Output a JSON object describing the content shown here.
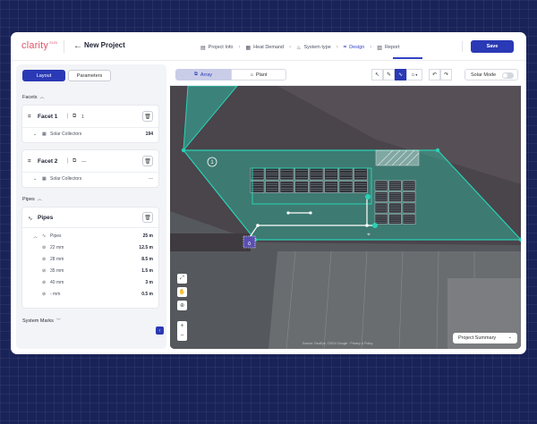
{
  "app": {
    "logo": "clarity",
    "logo_sup": "SUN",
    "project_title": "New Project",
    "back_icon": "arrow-left-icon",
    "save_label": "Save"
  },
  "steps": [
    {
      "label": "Project Info",
      "icon": "document-icon",
      "active": false
    },
    {
      "label": "Heat Demand",
      "icon": "table-icon",
      "active": false
    },
    {
      "label": "System type",
      "icon": "flame-icon",
      "active": false
    },
    {
      "label": "Design",
      "icon": "design-icon",
      "active": true
    },
    {
      "label": "Report",
      "icon": "report-icon",
      "active": false
    }
  ],
  "sidebar": {
    "tabs": {
      "layout": "Layout",
      "parameters": "Parameters"
    },
    "facets_label": "Facets",
    "facet1": {
      "title": "Facet 1",
      "count": "1",
      "sub": "Solar Collectors",
      "value": "194"
    },
    "facet2": {
      "title": "Facet 2",
      "count": "—",
      "sub": "Solar Collectors",
      "value": "—"
    },
    "pipes_label": "Pipes",
    "pipes_card": {
      "title": "Pipes",
      "summary_label": "Pipes",
      "summary_value": "25 m",
      "rows": [
        {
          "label": "22 mm",
          "value": "12.5 m"
        },
        {
          "label": "28 mm",
          "value": "8.5 m"
        },
        {
          "label": "35 mm",
          "value": "1.5 m"
        },
        {
          "label": "40 mm",
          "value": "3 m"
        },
        {
          "label": "- mm",
          "value": "0.5 m"
        }
      ]
    },
    "system_marks_label": "System Marks"
  },
  "map": {
    "tabs": {
      "array": "Array",
      "plant": "Plant"
    },
    "solar_mode_label": "Solar Mode",
    "solar_mode_on": false,
    "facet_badge": "1",
    "project_summary_label": "Project Summary",
    "attribution": "Source: GeoEye, ©2024 Google  ·  Privacy & Policy",
    "colors": {
      "facet": "#2ad1b4",
      "accent": "#2a39b5"
    }
  }
}
